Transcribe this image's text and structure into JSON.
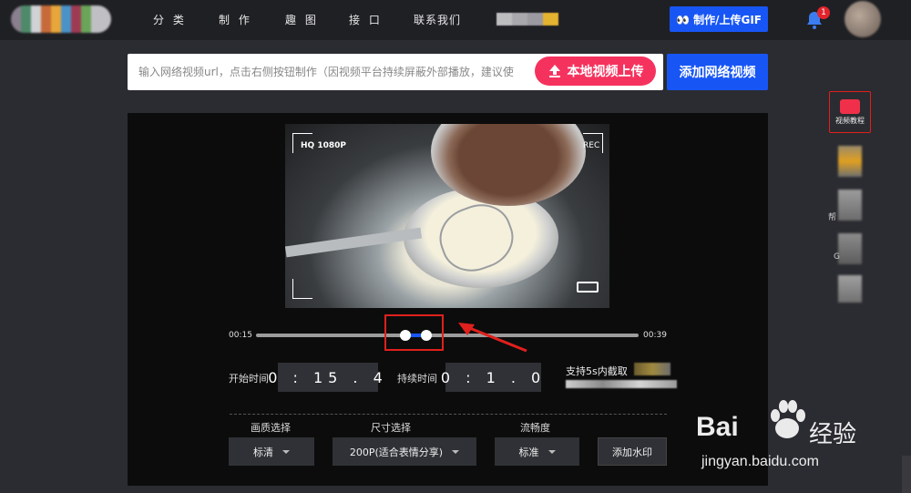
{
  "nav": {
    "items": [
      "分 类",
      "制 作",
      "趣 图",
      "接 口",
      "联系我们"
    ],
    "upload_gif": "👀 制作/上传GIF",
    "notification_count": "1"
  },
  "toolbar": {
    "url_placeholder": "输入网络视频url，点击右侧按钮制作（因视频平台持续屏蔽外部播放，建议使",
    "local_upload": "本地视频上传",
    "add_network": "添加网络视频"
  },
  "preview": {
    "hud_quality": "HQ 1080P",
    "hud_rec": "REC"
  },
  "slider": {
    "start_label": "00:15",
    "end_label": "00:39",
    "range_start_fraction": 0.39,
    "range_end_fraction": 0.445
  },
  "time_fields": {
    "start_label": "开始时间",
    "start_value": "0 : 15 . 4",
    "duration_label": "持续时间",
    "duration_value": "0 : 1 . 0",
    "support_text": "支持5s内截取"
  },
  "options": {
    "quality_label": "画质选择",
    "quality_value": "标清",
    "size_label": "尺寸选择",
    "size_value": "200P(适合表情分享)",
    "fluency_label": "流畅度",
    "fluency_value": "标准",
    "watermark_button": "添加水印"
  },
  "sidebar": {
    "tutorial_label": "视频教程",
    "glyph_help": "帮",
    "glyph_g": "G"
  },
  "watermark": {
    "logo_text": "Bai",
    "logo_cn": "经验",
    "url": "jingyan.baidu.com"
  },
  "colors": {
    "accent_blue": "#1756f5",
    "accent_pink": "#f5325e",
    "highlight_red": "#e0201c"
  }
}
